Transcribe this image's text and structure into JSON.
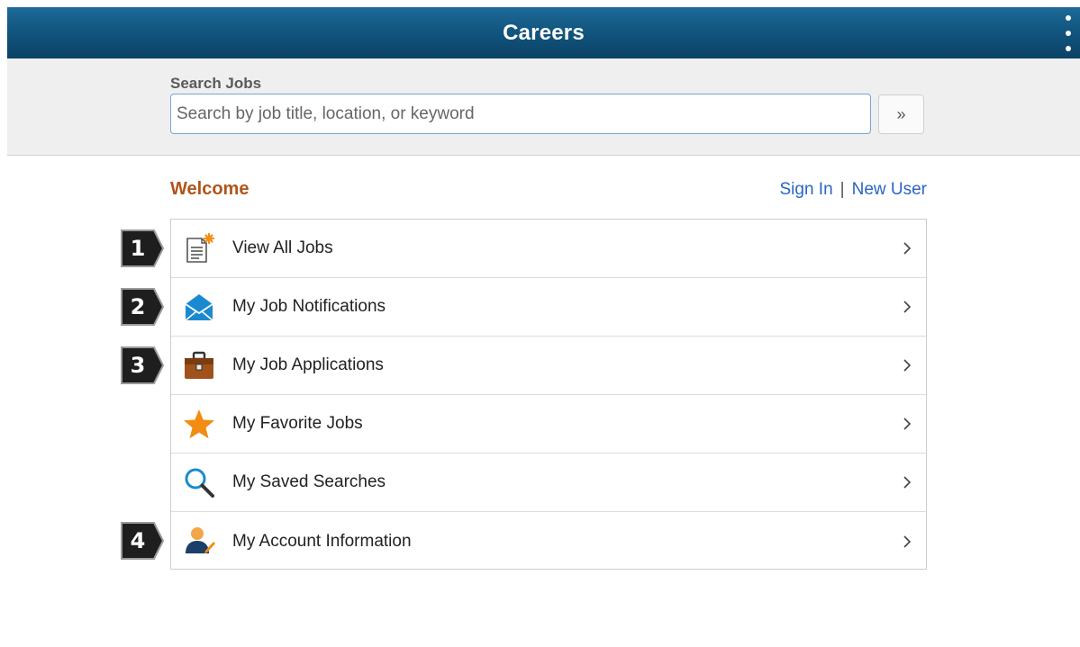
{
  "header": {
    "title": "Careers",
    "menu_icon": "kebab-menu-icon"
  },
  "search": {
    "label": "Search Jobs",
    "placeholder": "Search by job title, location, or keyword",
    "button_label": "»"
  },
  "welcome": {
    "heading": "Welcome",
    "sign_in": "Sign In",
    "separator": "|",
    "new_user": "New User"
  },
  "menu": {
    "items": [
      {
        "label": "View All Jobs",
        "icon": "new-document-icon"
      },
      {
        "label": "My Job Notifications",
        "icon": "envelope-icon"
      },
      {
        "label": "My Job Applications",
        "icon": "briefcase-icon"
      },
      {
        "label": "My Favorite Jobs",
        "icon": "star-icon"
      },
      {
        "label": "My Saved Searches",
        "icon": "magnifier-icon"
      },
      {
        "label": "My Account Information",
        "icon": "user-edit-icon"
      }
    ]
  },
  "callouts": [
    "1",
    "2",
    "3",
    "4"
  ],
  "colors": {
    "header": "#125680",
    "welcome": "#b0541a",
    "link": "#2b64c4",
    "star": "#f28c12"
  }
}
